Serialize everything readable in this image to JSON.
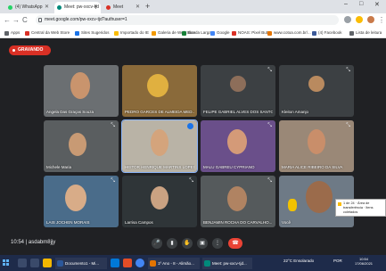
{
  "browser": {
    "tabs": [
      {
        "label": "(4) WhatsApp",
        "color": "#25d366"
      },
      {
        "label": "Meet: pw-xxcv-tjd",
        "color": "#00897b"
      },
      {
        "label": "Meet",
        "color": "#d93025"
      }
    ],
    "new_tab": "+",
    "window_controls": {
      "minimize": "–",
      "maximize": "□",
      "close": "✕"
    },
    "nav": {
      "back": "←",
      "forward": "→",
      "reload": "C",
      "home": "⌂"
    },
    "url": "meet.google.com/pw-xxcv-tjd?authuser=1",
    "bookmarks": [
      {
        "label": "Apps",
        "color": "#5f6368"
      },
      {
        "label": "Central da Web Store",
        "color": "#d93025"
      },
      {
        "label": "Sites Sugeridos",
        "color": "#1a73e8"
      },
      {
        "label": "Importado do IE",
        "color": "#fbbc04"
      },
      {
        "label": "Galeria de Web Slice",
        "color": "#f29900"
      },
      {
        "label": "Banda Larga",
        "color": "#188038"
      },
      {
        "label": "Google",
        "color": "#4285f4"
      },
      {
        "label": "NOAS: Pixel Butt...",
        "color": "#d93025"
      },
      {
        "label": "www.cotoa.com.br/...",
        "color": "#e37400"
      },
      {
        "label": "(4) Facebook",
        "color": "#3b5998"
      },
      {
        "label": "Lista de leitura",
        "color": "#5f6368"
      }
    ]
  },
  "meet": {
    "recording_label": "GRAVANDO",
    "participants": [
      {
        "name": "Angela Das Graças Souza",
        "bg": "#6b6f72",
        "skin": "#c9946d"
      },
      {
        "name": "PEDRO GARCES DE ALMEIDA MED...",
        "bg": "#8a6a3a",
        "skin": "#e0b040"
      },
      {
        "name": "FELIPE GABRIEL ALVES DOS SANTOS",
        "bg": "#3c4043",
        "skin": "#8d6e5a"
      },
      {
        "name": "Kleiton Amanjo",
        "bg": "#3c4043",
        "skin": "#b98a5f"
      },
      {
        "name": "Michele Maria",
        "bg": "#5a5e60",
        "skin": "#c89a74"
      },
      {
        "name": "HEITOR HENRIQUE MARTINS LOPES",
        "bg": "#b9b3a6",
        "skin": "#d4a47c"
      },
      {
        "name": "MALU GABREU CYPRIANO",
        "bg": "#6a4f8a",
        "skin": "#d49a78"
      },
      {
        "name": "MARIA ALICE RIBEIRO DA SILVA",
        "bg": "#9a8877",
        "skin": "#c98e6a"
      },
      {
        "name": "LAIS JOCHEN MORAIS",
        "bg": "#4a6c8a",
        "skin": "#d8ac88"
      },
      {
        "name": "Larrisa Campos",
        "bg": "#2f3538",
        "skin": "#caa282"
      },
      {
        "name": "BENJAMIN ROCHA DO CARVALHO...",
        "bg": "#555a5c",
        "skin": "#b08362"
      },
      {
        "name": "Você",
        "bg": "#6e7a86",
        "skin": "#9b6b4b"
      }
    ],
    "time": "10:54",
    "meeting_code": "asdabm8jjy",
    "controls": {
      "mic": "🎤",
      "camera": "▮",
      "hand": "✋",
      "present": "▣",
      "more": "⋮",
      "end": "☎"
    },
    "toast_text": "1 de 24 · Área de transferência · Itens coletados"
  },
  "taskbar": {
    "items": [
      {
        "label": "Documento1 - Mi...",
        "color": "#2b579a"
      },
      {
        "label": "1º Ano - 8 - Alimão...",
        "color": "#e37400"
      },
      {
        "label": "Meet: pw-xxcv-tjd...",
        "color": "#00897b"
      }
    ],
    "weather": "22°C Ensolarado",
    "lang": "POR",
    "clock": "10:54",
    "date": "17/06/2021"
  },
  "colors": {
    "accent": "#1a73e8",
    "danger": "#ea4335",
    "bg": "#202124"
  }
}
